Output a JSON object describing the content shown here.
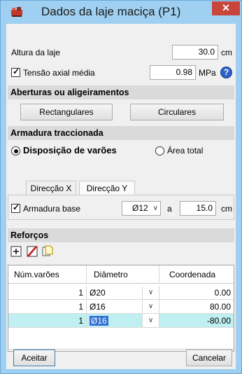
{
  "window": {
    "title": "Dados da laje maciça (P1)",
    "close_glyph": "✕",
    "icon": "slab-app-icon"
  },
  "slab_height": {
    "label": "Altura da laje",
    "value": "30.0",
    "unit": "cm"
  },
  "axial_stress": {
    "checked": true,
    "label": "Tensão axial média",
    "value": "0.98",
    "unit": "MPa",
    "help_glyph": "?"
  },
  "openings": {
    "header": "Aberturas ou aligeiramentos",
    "buttons": [
      "Rectangulares",
      "Circulares"
    ]
  },
  "tension_reinforcement": {
    "header": "Armadura traccionada",
    "radio_options": [
      {
        "label": "Disposição de varões",
        "selected": true
      },
      {
        "label": "Área total",
        "selected": false
      }
    ],
    "tabs": [
      {
        "label": "Direcção X",
        "active": true
      },
      {
        "label": "Direcção Y",
        "active": false
      }
    ],
    "base": {
      "checked": true,
      "label": "Armadura base",
      "diameter": "Ø12",
      "spacing_label": "a",
      "spacing": "15.0",
      "unit": "cm"
    }
  },
  "reinforcements": {
    "header": "Reforços",
    "toolbar": [
      "add-row-icon",
      "delete-row-icon",
      "copy-row-icon"
    ],
    "columns": [
      "Núm.varões",
      "Diâmetro",
      "Coordenada"
    ],
    "rows": [
      {
        "count": "1",
        "diameter": "Ø20",
        "coordinate": "0.00",
        "selected": false
      },
      {
        "count": "1",
        "diameter": "Ø16",
        "coordinate": "80.00",
        "selected": false
      },
      {
        "count": "1",
        "diameter": "Ø16",
        "coordinate": "-80.00",
        "selected": true
      }
    ]
  },
  "footer": {
    "accept": "Aceitar",
    "cancel": "Cancelar"
  },
  "colors": {
    "titlebar": "#9fd0f1",
    "close": "#c9443a",
    "section": "#dadada",
    "selected_row": "#bfeff0",
    "selected_cell": "#2f6fd6"
  }
}
